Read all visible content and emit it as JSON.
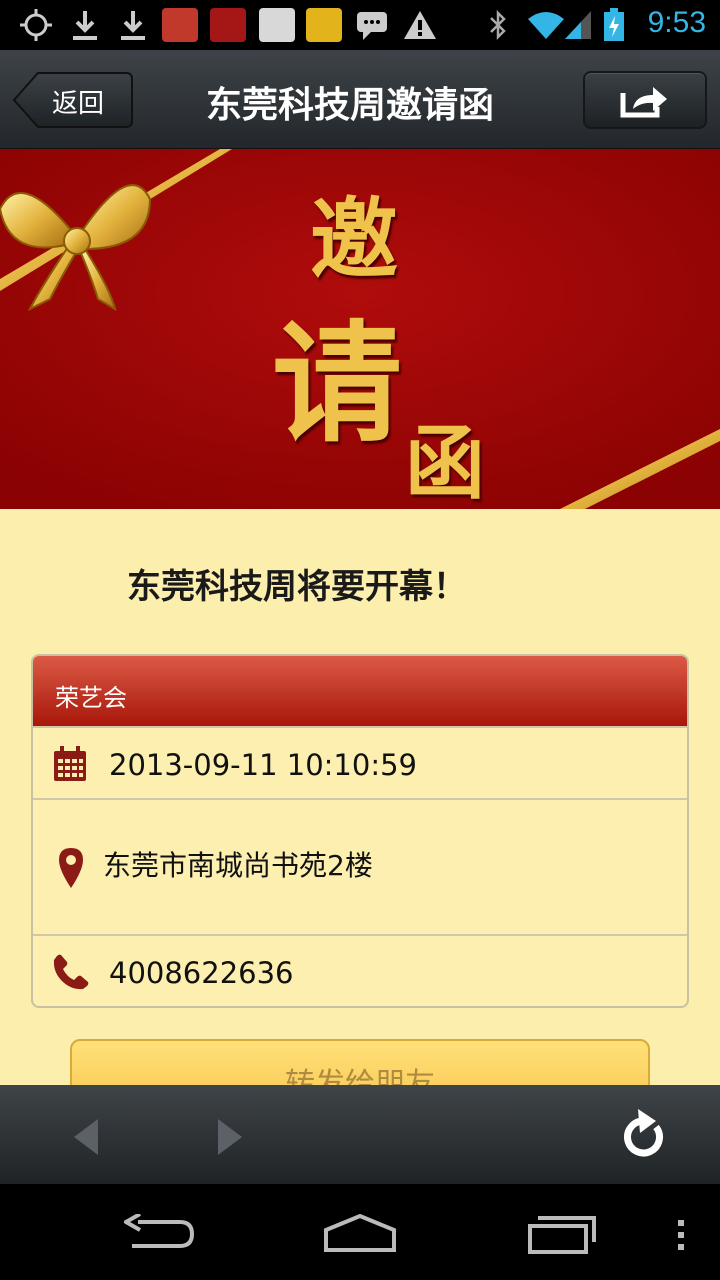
{
  "status_bar": {
    "time": "9:53",
    "icons": [
      "gps-icon",
      "download-icon",
      "download-icon",
      "app-notification-icon",
      "app-notification-icon",
      "app-notification-icon",
      "app-notification-icon",
      "chat-icon",
      "warning-icon",
      "bluetooth-icon",
      "wifi-icon",
      "signal-icon",
      "battery-icon"
    ]
  },
  "header": {
    "back_label": "返回",
    "title": "东莞科技周邀请函",
    "share_icon": "share-icon"
  },
  "banner": {
    "text": [
      "邀",
      "请",
      "函"
    ],
    "background": "#9a0505",
    "gold": "#e0b040"
  },
  "content": {
    "headline": "东莞科技周将要开幕！",
    "card": {
      "organizer": "荣艺会",
      "datetime": "2013-09-11 10:10:59",
      "address": "东莞市南城尚书苑2楼",
      "phone": "4008622636"
    },
    "forward_label": "转发给朋友"
  },
  "colors": {
    "accent_red": "#b01e10",
    "cream": "#fcefad",
    "icon_dark_red": "#8a1b15",
    "status_blue": "#33b5e5"
  }
}
